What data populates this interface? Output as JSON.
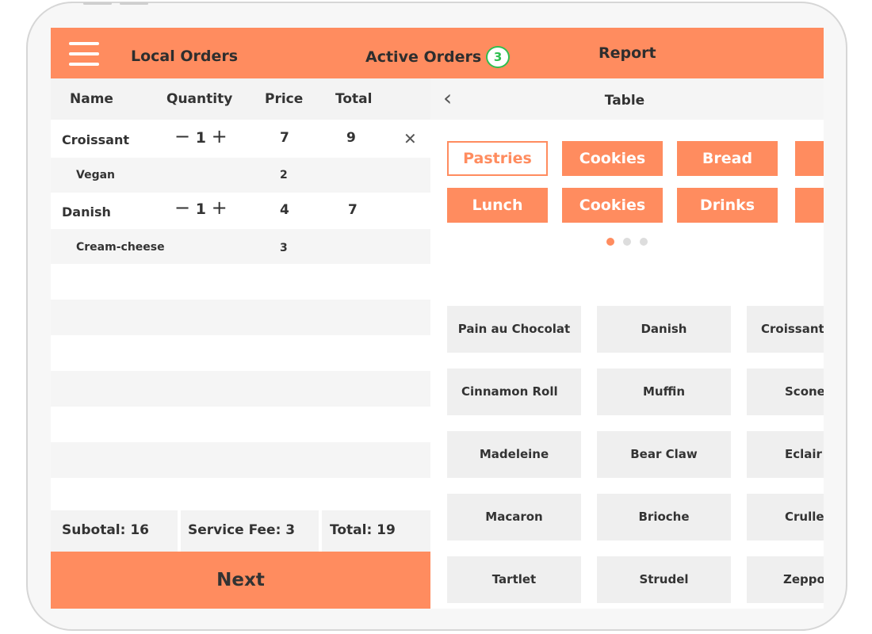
{
  "header": {
    "local_orders": "Local Orders",
    "active_orders": "Active Orders",
    "active_count": "3",
    "report": "Report"
  },
  "order": {
    "columns": {
      "name": "Name",
      "quantity": "Quantity",
      "price": "Price",
      "total": "Total"
    },
    "items": [
      {
        "name": "Croissant",
        "qty": "1",
        "price": "7",
        "total": "9",
        "addon": {
          "name": "Vegan",
          "price": "2"
        }
      },
      {
        "name": "Danish",
        "qty": "1",
        "price": "4",
        "total": "7",
        "addon": {
          "name": "Cream-cheese",
          "price": "3"
        }
      }
    ],
    "subtotal": "Subotal: 16",
    "service_fee": "Service Fee: 3",
    "total": "Total: 19",
    "next_label": "Next"
  },
  "menu": {
    "title": "Table",
    "categories": [
      "Pastries",
      "Cookies",
      "Bread",
      "Lunch",
      "Cookies",
      "Drinks"
    ],
    "selected_category": "Pastries",
    "pages": 3,
    "current_page": 1,
    "products": [
      "Pain au Chocolat",
      "Danish",
      "Croissant",
      "Cinnamon Roll",
      "Muffin",
      "Scone",
      "Madeleine",
      "Bear Claw",
      "Eclair",
      "Macaron",
      "Brioche",
      "Cruller",
      "Tartlet",
      "Strudel",
      "Zeppole"
    ]
  },
  "colors": {
    "accent": "#ff8c5f",
    "badge": "#2fbf4f",
    "panel_gray": "#f3f3f3"
  }
}
